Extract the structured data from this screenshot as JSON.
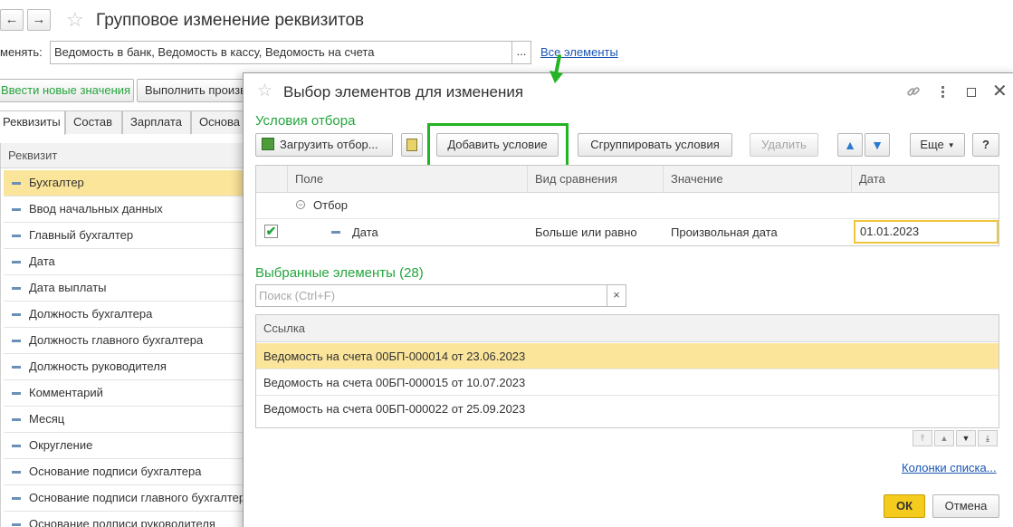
{
  "window": {
    "title": "Групповое изменение реквизитов",
    "back_icon": "←",
    "forward_icon": "→"
  },
  "change_field": {
    "label": "менять:",
    "value": "Ведомость в банк, Ведомость в кассу, Ведомость на счета",
    "select_label": "...",
    "all_link": "Все элементы"
  },
  "toolbar": {
    "enter_new": "Ввести новые значения",
    "execute": "Выполнить произв"
  },
  "tabs": [
    "Реквизиты",
    "Состав",
    "Зарплата",
    "Основа"
  ],
  "left_list": {
    "header": "Реквизит",
    "items": [
      "Бухгалтер",
      "Ввод начальных данных",
      "Главный бухгалтер",
      "Дата",
      "Дата выплаты",
      "Должность бухгалтера",
      "Должность главного бухгалтера",
      "Должность руководителя",
      "Комментарий",
      "Месяц",
      "Округление",
      "Основание подписи бухгалтера",
      "Основание подписи главного бухгалтер",
      "Основание подписи руководителя"
    ]
  },
  "dialog": {
    "title": "Выбор элементов для изменения",
    "filter_section": "Условия отбора",
    "buttons": {
      "load_filter": "Загрузить отбор...",
      "add_condition": "Добавить условие",
      "group_conditions": "Сгруппировать условия",
      "delete": "Удалить",
      "more": "Еще",
      "help": "?"
    },
    "filter_columns": [
      "Поле",
      "Вид сравнения",
      "Значение",
      "Дата"
    ],
    "filter_group": "Отбор",
    "filter_row": {
      "field": "Дата",
      "comparison": "Больше или равно",
      "value": "Произвольная дата",
      "date": "01.01.2023"
    },
    "selected_section": "Выбранные элементы (28)",
    "search_placeholder": "Поиск (Ctrl+F)",
    "search_clear": "×",
    "elements_header": "Ссылка",
    "elements": [
      "Ведомость на счета 00БП-000014 от 23.06.2023",
      "Ведомость на счета 00БП-000015 от 10.07.2023",
      "Ведомость на счета 00БП-000022 от 25.09.2023"
    ],
    "columns_link": "Колонки списка...",
    "ok": "ОК",
    "cancel": "Отмена"
  },
  "colors": {
    "accent_green": "#23a53c",
    "highlight_yellow": "#fbe59a",
    "ok_yellow": "#f5cc1e",
    "link_blue": "#1a55b4",
    "annotation_green": "#22b422"
  }
}
